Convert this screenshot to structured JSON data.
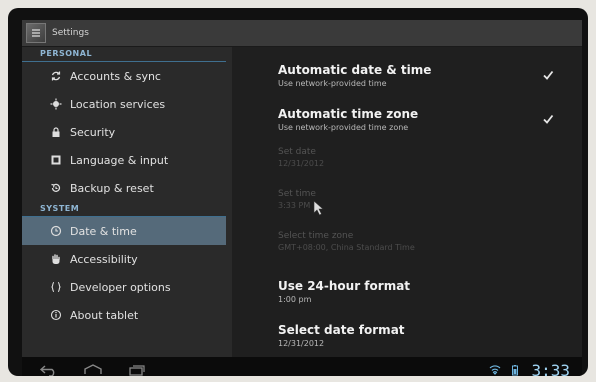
{
  "window": {
    "title": "Settings"
  },
  "sidebar": {
    "personal_header": "PERSONAL",
    "system_header": "SYSTEM",
    "personal_items": [
      {
        "label": "Accounts & sync",
        "icon": "sync-icon"
      },
      {
        "label": "Location services",
        "icon": "location-icon"
      },
      {
        "label": "Security",
        "icon": "lock-icon"
      },
      {
        "label": "Language & input",
        "icon": "language-icon"
      },
      {
        "label": "Backup & reset",
        "icon": "backup-icon"
      }
    ],
    "system_items": [
      {
        "label": "Date & time",
        "icon": "clock-icon",
        "selected": true
      },
      {
        "label": "Accessibility",
        "icon": "hand-icon"
      },
      {
        "label": "Developer options",
        "icon": "braces-icon"
      },
      {
        "label": "About tablet",
        "icon": "info-icon"
      }
    ]
  },
  "content": {
    "settings": [
      {
        "title": "Automatic date & time",
        "summary": "Use network-provided time",
        "checked": true
      },
      {
        "title": "Automatic time zone",
        "summary": "Use network-provided time zone",
        "checked": true
      },
      {
        "title": "Set date",
        "summary": "12/31/2012",
        "disabled": true
      },
      {
        "title": "Set time",
        "summary": "3:33 PM",
        "disabled": true
      },
      {
        "title": "Select time zone",
        "summary": "GMT+08:00, China Standard Time",
        "disabled": true
      },
      {
        "title": "Use 24-hour format",
        "summary": "1:00 pm"
      },
      {
        "title": "Select date format",
        "summary": "12/31/2012"
      }
    ]
  },
  "status_bar": {
    "clock": "3:33"
  },
  "colors": {
    "accent": "#33b5e5",
    "selected_row": "#556a7a"
  }
}
